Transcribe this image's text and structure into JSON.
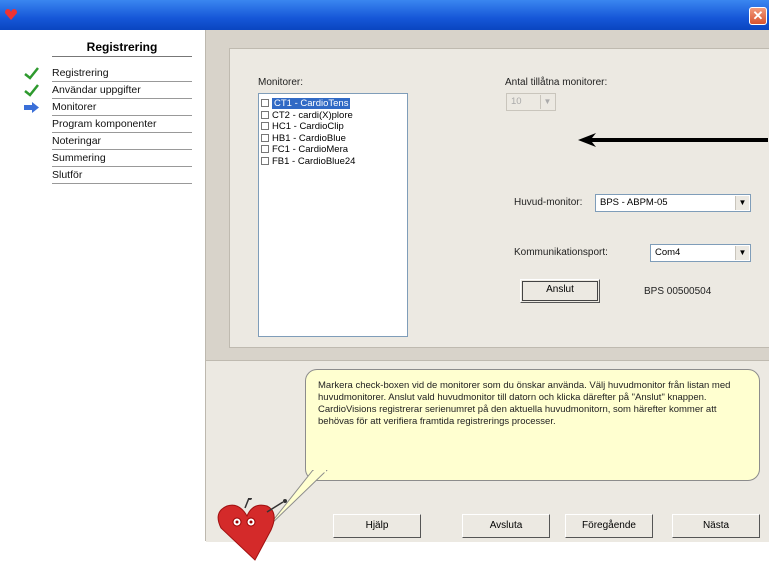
{
  "window": {
    "close_glyph": "✕",
    "icon": "app-logo-icon"
  },
  "sidebar": {
    "title": "Registrering",
    "items": [
      {
        "label": "Registrering",
        "state": "done"
      },
      {
        "label": "Användar uppgifter",
        "state": "done"
      },
      {
        "label": "Monitorer",
        "state": "current"
      },
      {
        "label": "Program komponenter",
        "state": "pending"
      },
      {
        "label": "Noteringar",
        "state": "pending"
      },
      {
        "label": "Summering",
        "state": "pending"
      },
      {
        "label": "Slutför",
        "state": "pending"
      }
    ]
  },
  "monitors": {
    "label": "Monitorer:",
    "items": [
      {
        "label": "CT1 - CardioTens",
        "checked": false,
        "selected": true
      },
      {
        "label": "CT2 - cardi(X)plore",
        "checked": false,
        "selected": false
      },
      {
        "label": "HC1 - CardioClip",
        "checked": false,
        "selected": false
      },
      {
        "label": "HB1 - CardioBlue",
        "checked": false,
        "selected": false
      },
      {
        "label": "FC1 - CardioMera",
        "checked": false,
        "selected": false
      },
      {
        "label": "FB1 - CardioBlue24",
        "checked": false,
        "selected": false
      }
    ]
  },
  "allowed": {
    "label": "Antal tillåtna monitorer:",
    "value": "10"
  },
  "main_monitor": {
    "label": "Huvud-monitor:",
    "value": "BPS - ABPM-05"
  },
  "comm_port": {
    "label": "Kommunikationsport:",
    "value": "Com4"
  },
  "connect": {
    "label": "Anslut",
    "serial": "BPS 00500504"
  },
  "help_text": "Markera check-boxen vid de monitorer som du önskar använda. Välj huvudmonitor från listan med huvudmonitorer. Anslut vald huvudmonitor till datorn och klicka därefter på \"Anslut\" knappen. CardioVisions registrerar serienumret på den aktuella huvudmonitorn, som härefter kommer att behövas för att verifiera framtida registrerings processer.",
  "nav": {
    "help": "Hjälp",
    "exit": "Avsluta",
    "prev": "Föregående",
    "next": "Nästa"
  },
  "colors": {
    "titlebar": "#1657d8",
    "selection": "#316ac5",
    "bubble": "#ffffd0",
    "check": "#2e9a2e",
    "arrow": "#1f5fd0"
  }
}
